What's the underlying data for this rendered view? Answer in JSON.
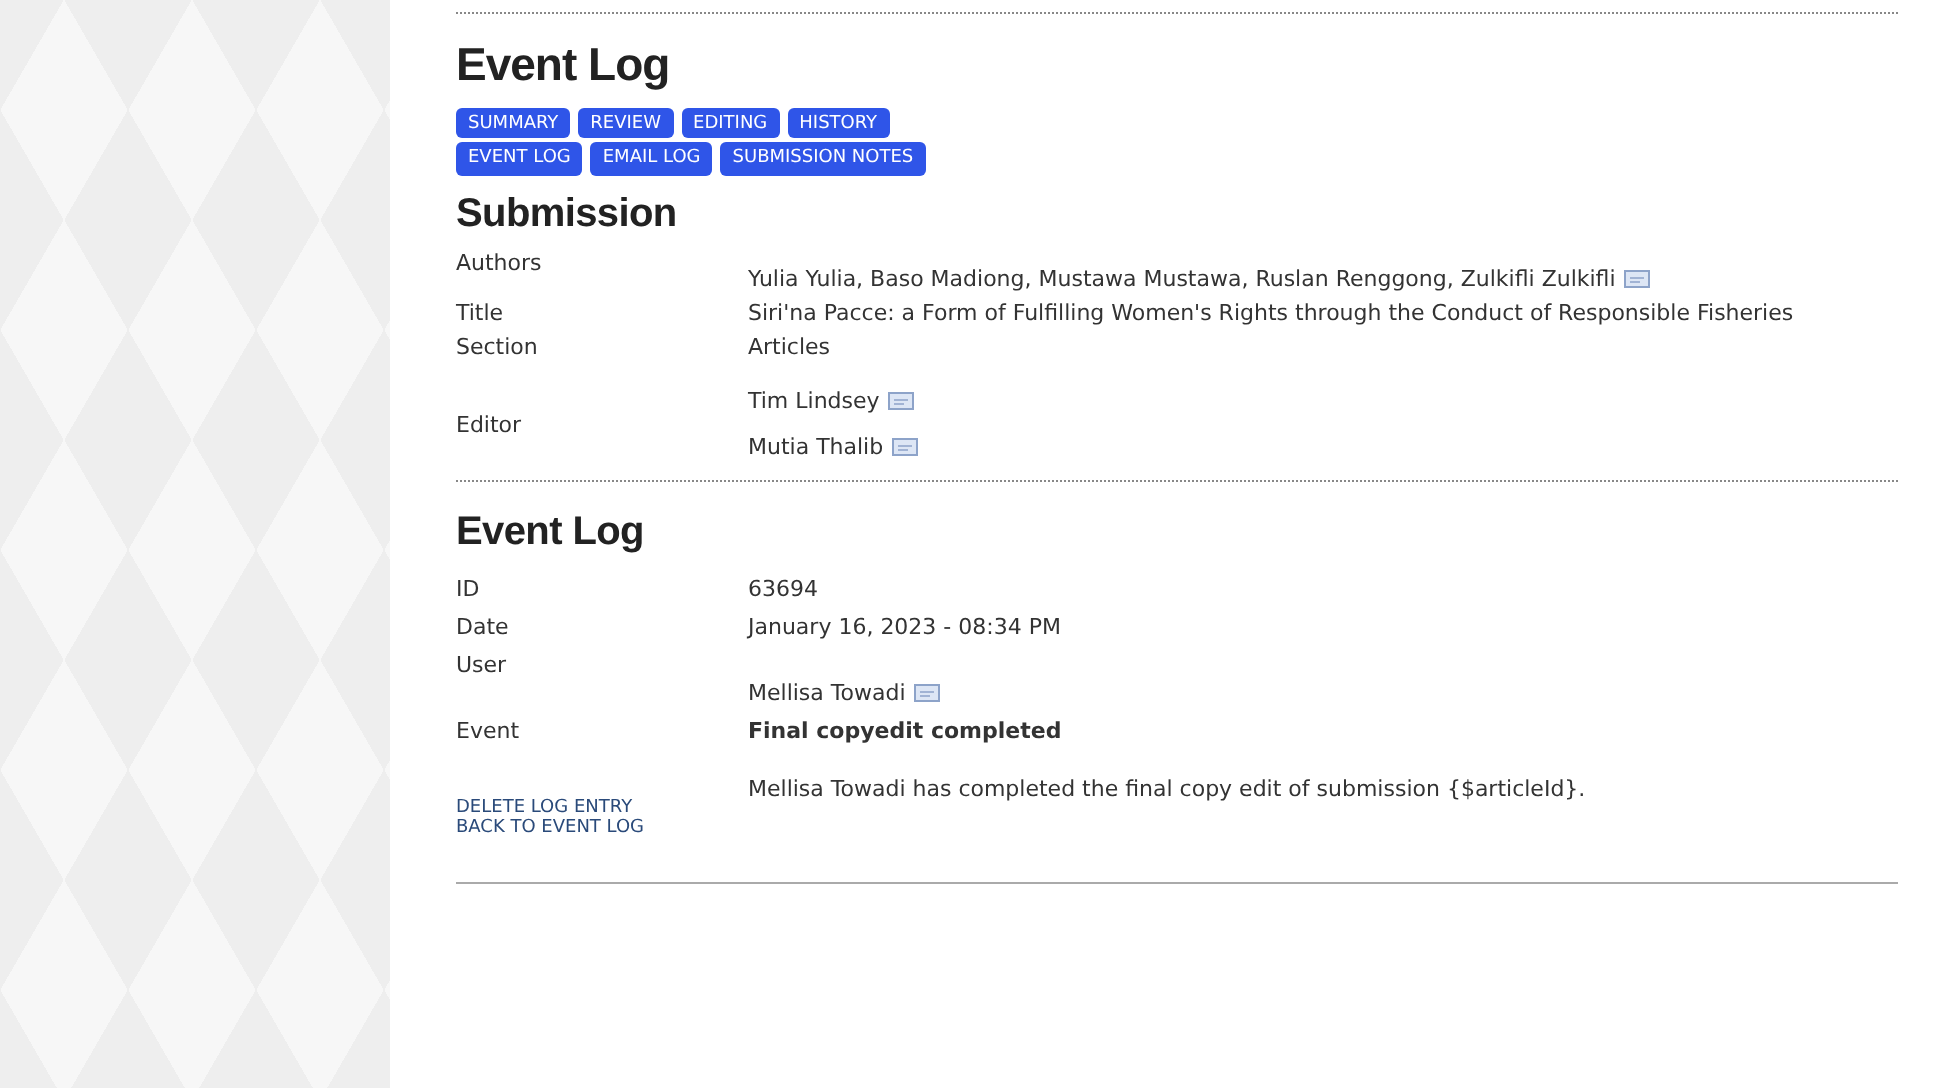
{
  "page_title": "Event Log",
  "tab_rows": [
    [
      "SUMMARY",
      "REVIEW",
      "EDITING",
      "HISTORY"
    ],
    [
      "EVENT LOG",
      "EMAIL LOG",
      "SUBMISSION NOTES"
    ]
  ],
  "submission": {
    "heading": "Submission",
    "rows": [
      {
        "label": "Authors",
        "values": [
          {
            "text": "Yulia Yulia, Baso Madiong, Mustawa Mustawa, Ruslan Renggong, Zulkifli Zulkifli",
            "mail": true
          }
        ]
      },
      {
        "label": "Title",
        "values": [
          {
            "text": "Siri'na Pacce: a Form of Fulfilling Women's Rights through the Conduct of Responsible Fisheries",
            "mail": false
          }
        ]
      },
      {
        "label": "Section",
        "values": [
          {
            "text": "Articles",
            "mail": false
          }
        ]
      },
      {
        "label": "Editor",
        "values": [
          {
            "text": "Tim Lindsey",
            "mail": true
          },
          {
            "text": "Mutia Thalib",
            "mail": true
          }
        ]
      }
    ]
  },
  "event_log": {
    "heading": "Event Log",
    "rows": [
      {
        "label": "ID",
        "value": "63694",
        "kind": "plain"
      },
      {
        "label": "Date",
        "value": "January 16, 2023 - 08:34 PM",
        "kind": "plain"
      },
      {
        "label": "User",
        "value": "Mellisa Towadi",
        "kind": "user"
      },
      {
        "label": "Event",
        "value": "Final copyedit completed",
        "kind": "bold"
      }
    ],
    "message": "Mellisa Towadi has completed the final copy edit of submission {$articleId}.",
    "links": [
      "DELETE LOG ENTRY",
      "BACK TO EVENT LOG"
    ]
  }
}
